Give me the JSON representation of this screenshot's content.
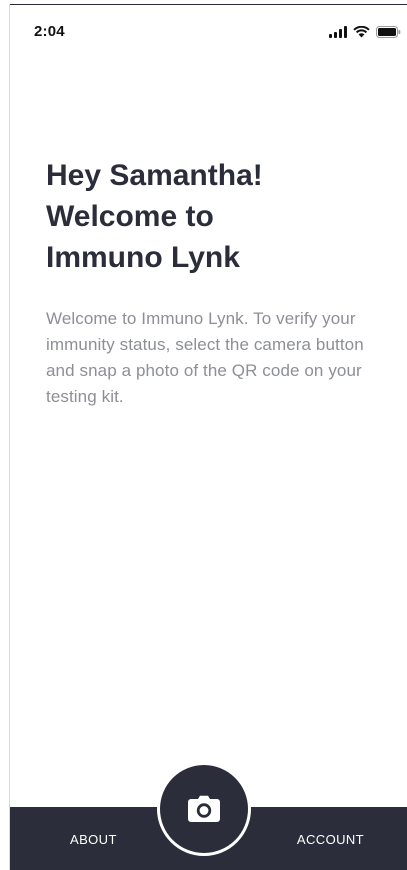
{
  "status_bar": {
    "time": "2:04",
    "icons": [
      "signal-icon",
      "wifi-icon",
      "battery-icon"
    ]
  },
  "welcome": {
    "title_lines": [
      "Hey Samantha!",
      "Welcome to",
      "Immuno Lynk"
    ],
    "body": "Welcome to Immuno Lynk. To verify your immunity status, select the camera button and snap a photo of the QR code on your testing kit."
  },
  "tab_bar": {
    "about_label": "ABOUT",
    "account_label": "ACCOUNT",
    "camera_icon": "camera-icon"
  },
  "colors": {
    "primary_dark": "#2b2e3a",
    "body_text": "#8d8f96",
    "background": "#ffffff"
  }
}
